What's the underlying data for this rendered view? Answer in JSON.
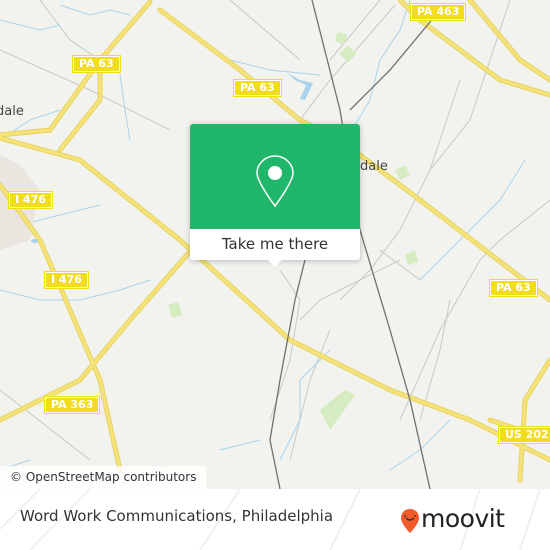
{
  "map": {
    "background_color": "#f2f2ee",
    "road_color": "#f5e37a",
    "water_color": "#a9d3ec",
    "park_color": "#d5ebc0",
    "rail_color": "#707070",
    "shields": [
      {
        "label": "PA 463"
      },
      {
        "label": "PA 63"
      },
      {
        "label": "PA 63"
      },
      {
        "label": "I 476"
      },
      {
        "label": "I 476"
      },
      {
        "label": "PA 63"
      },
      {
        "label": "PA 363"
      },
      {
        "label": "US 202"
      }
    ],
    "places": [
      {
        "label": "dale"
      },
      {
        "label": "dale"
      }
    ],
    "attribution": "© OpenStreetMap contributors"
  },
  "popup": {
    "icon": "map-pin-icon",
    "accent_color": "#21b76a",
    "button_label": "Take me there"
  },
  "footer": {
    "title": "Word Work Communications, Philadelphia",
    "brand": "moovit",
    "brand_color": "#f15a29"
  }
}
